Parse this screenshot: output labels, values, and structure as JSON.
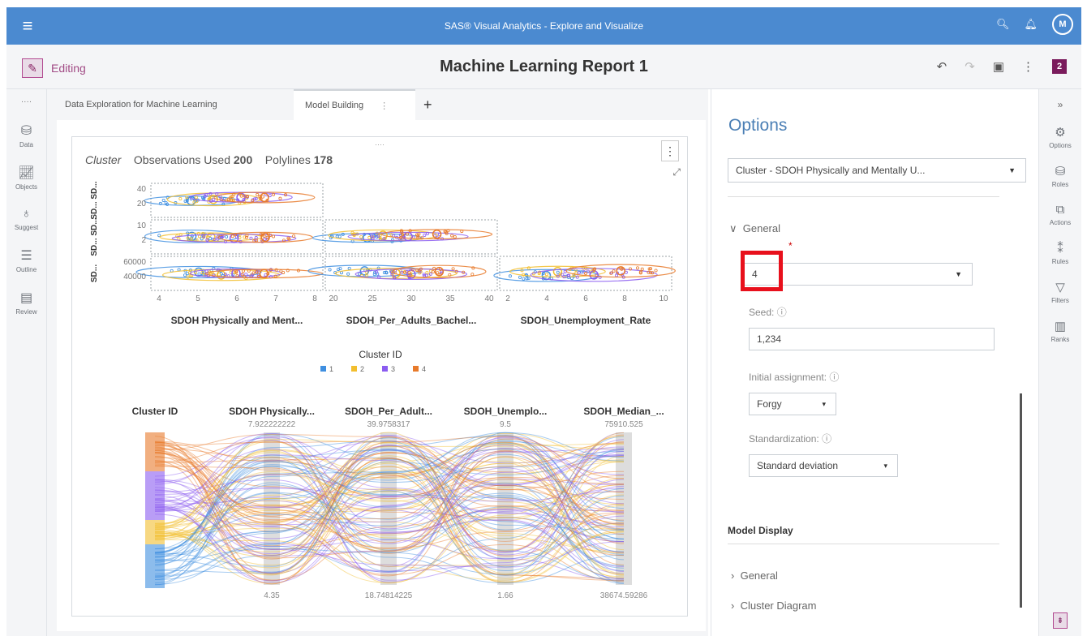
{
  "app": {
    "title": "SAS® Visual Analytics - Explore and Visualize",
    "avatar_letter": "M",
    "accent": "#4b8ad0"
  },
  "header": {
    "edit_label": "Editing",
    "report_title": "Machine Learning Report 1",
    "badge": "2"
  },
  "left_nav": {
    "items": [
      {
        "label": "Data",
        "icon": "database-icon"
      },
      {
        "label": "Objects",
        "icon": "chart-icon"
      },
      {
        "label": "Suggest",
        "icon": "lightbulb-icon"
      },
      {
        "label": "Outline",
        "icon": "outline-list-icon"
      },
      {
        "label": "Review",
        "icon": "review-icon"
      }
    ]
  },
  "tabs": [
    {
      "label": "Data Exploration for Machine Learning"
    },
    {
      "label": "Model Building"
    }
  ],
  "viz": {
    "header_type": "Cluster",
    "obs_label": "Observations Used",
    "obs_value": "200",
    "poly_label": "Polylines",
    "poly_value": "178",
    "matrix_xlabels": [
      "SDOH Physically and Ment...",
      "SDOH_Per_Adults_Bachel...",
      "SDOH_Unemployment_Rate"
    ],
    "matrix_ylabels": [
      "SD... SD...",
      "SD... SD...",
      "SD..."
    ],
    "row_ticks": [
      [
        "40",
        "20"
      ],
      [
        "10",
        "2"
      ],
      [
        "60000",
        "40000"
      ]
    ],
    "col_ticks": [
      [
        "4",
        "5",
        "6",
        "7",
        "8"
      ],
      [
        "20",
        "25",
        "30",
        "35",
        "40"
      ],
      [
        "2",
        "4",
        "6",
        "8",
        "10"
      ]
    ],
    "legend_title": "Cluster ID",
    "legend_items": [
      {
        "label": "1",
        "color": "#3f8fe0"
      },
      {
        "label": "2",
        "color": "#f2be2e"
      },
      {
        "label": "3",
        "color": "#8b5cf0"
      },
      {
        "label": "4",
        "color": "#e87a2b"
      }
    ],
    "parallel_axes": [
      {
        "label": "Cluster ID",
        "max": "",
        "min": ""
      },
      {
        "label": "SDOH Physically...",
        "max": "7.922222222",
        "min": "4.35"
      },
      {
        "label": "SDOH_Per_Adult...",
        "max": "39.9758317",
        "min": "18.74814225"
      },
      {
        "label": "SDOH_Unemplo...",
        "max": "9.5",
        "min": "1.66"
      },
      {
        "label": "SDOH_Median_...",
        "max": "75910.525",
        "min": "38674.59286"
      }
    ]
  },
  "options": {
    "title": "Options",
    "object_select": "Cluster - SDOH Physically and Mentally U...",
    "general_label": "General",
    "clusters_value": "4",
    "seed_label": "Seed:",
    "seed_value": "1,234",
    "init_label": "Initial assignment:",
    "init_value": "Forgy",
    "std_label": "Standardization:",
    "std_value": "Standard deviation",
    "model_display": "Model Display",
    "md_general": "General",
    "md_cluster_diagram": "Cluster Diagram"
  },
  "right_nav": {
    "items": [
      {
        "label": "Options",
        "icon": "options-icon"
      },
      {
        "label": "Roles",
        "icon": "roles-icon"
      },
      {
        "label": "Actions",
        "icon": "actions-icon"
      },
      {
        "label": "Rules",
        "icon": "rules-icon"
      },
      {
        "label": "Filters",
        "icon": "filter-icon"
      },
      {
        "label": "Ranks",
        "icon": "ranks-icon"
      }
    ]
  }
}
